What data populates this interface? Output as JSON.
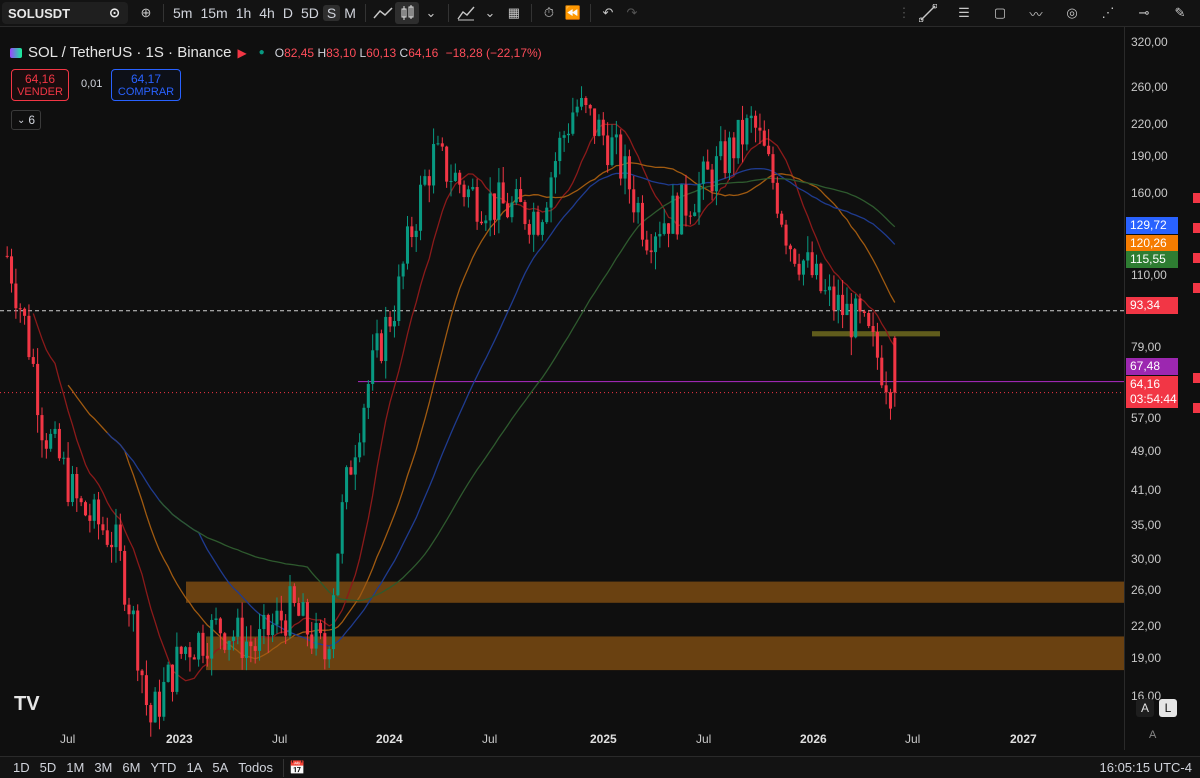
{
  "toolbar": {
    "symbol": "SOLUSDT",
    "intervals": [
      "5m",
      "15m",
      "1h",
      "4h",
      "D",
      "5D",
      "S",
      "M"
    ],
    "active_interval": "S"
  },
  "legend": {
    "title": "SOL / TetherUS · 1S · Binance",
    "o_label": "O",
    "o": "82,45",
    "h_label": "H",
    "h": "83,10",
    "l_label": "L",
    "l": "60,13",
    "c_label": "C",
    "c": "64,16",
    "change": "−18,28 (−22,17%)"
  },
  "trade": {
    "sell_price": "64,16",
    "sell_label": "VENDER",
    "spread": "0,01",
    "buy_price": "64,17",
    "buy_label": "COMPRAR",
    "indicator_count": "6"
  },
  "price_axis": {
    "ticks": [
      "320,00",
      "260,00",
      "220,00",
      "190,00",
      "160,00",
      "110,00",
      "79,00",
      "57,00",
      "49,00",
      "41,00",
      "35,00",
      "30,00",
      "26,00",
      "22,00",
      "19,00",
      "16,00"
    ],
    "tags": {
      "ma_blue": "129,72",
      "ma_orange": "120,26",
      "ma_green": "115,55",
      "dashed": "93,34",
      "purple_line": "67,48",
      "last_price": "64,16",
      "countdown": "03:54:44"
    },
    "colors": {
      "ma_blue": "#2962ff",
      "ma_orange": "#f57c00",
      "ma_green": "#2e7d32",
      "dashed": "#f23645",
      "purple": "#9c27b0",
      "last": "#f23645"
    }
  },
  "time_axis": {
    "labels": [
      {
        "text": "Jul",
        "year": false
      },
      {
        "text": "2023",
        "year": true
      },
      {
        "text": "Jul",
        "year": false
      },
      {
        "text": "2024",
        "year": true
      },
      {
        "text": "Jul",
        "year": false
      },
      {
        "text": "2025",
        "year": true
      },
      {
        "text": "Jul",
        "year": false
      },
      {
        "text": "2026",
        "year": true
      },
      {
        "text": "Jul",
        "year": false
      },
      {
        "text": "2027",
        "year": true
      }
    ]
  },
  "bottom": {
    "ranges": [
      "1D",
      "5D",
      "1M",
      "3M",
      "6M",
      "YTD",
      "1A",
      "5A",
      "Todos"
    ],
    "clock": "16:05:15 UTC-4"
  },
  "scale_buttons": {
    "auto": "A",
    "log": "L"
  },
  "chart_data": {
    "type": "candlestick",
    "symbol": "SOL / TetherUS",
    "interval": "1S",
    "exchange": "Binance",
    "scale": "log",
    "ylim": [
      14,
      330
    ],
    "x": [
      "2022-03",
      "2022-05",
      "2022-07",
      "2022-09",
      "2022-11",
      "2023-01",
      "2023-03",
      "2023-05",
      "2023-07",
      "2023-09",
      "2023-11",
      "2024-01",
      "2024-03",
      "2024-05",
      "2024-07",
      "2024-09",
      "2024-11",
      "2025-01",
      "2025-03",
      "2025-05",
      "2025-07",
      "2025-09",
      "2025-11",
      "2026-01",
      "2026-03",
      "2026-05"
    ],
    "close": [
      120,
      55,
      38,
      33,
      14,
      20,
      22,
      20,
      24,
      19,
      60,
      100,
      190,
      160,
      150,
      145,
      240,
      200,
      135,
      150,
      180,
      220,
      130,
      100,
      88,
      64
    ],
    "moving_averages": [
      {
        "color": "#2962ff",
        "last": 129.72
      },
      {
        "color": "#f57c00",
        "last": 120.26
      },
      {
        "color": "#2e7d32",
        "last": 115.55
      }
    ],
    "lines": [
      {
        "kind": "horizontal",
        "color": "#9c27b0",
        "value": 67.48
      },
      {
        "kind": "horizontal-dashed",
        "color": "#ffffff",
        "value": 93.34
      }
    ],
    "zones": [
      {
        "low": 24.5,
        "high": 27.0
      },
      {
        "low": 18.0,
        "high": 21.0
      },
      {
        "low": 83.0,
        "high": 85.0
      }
    ]
  }
}
